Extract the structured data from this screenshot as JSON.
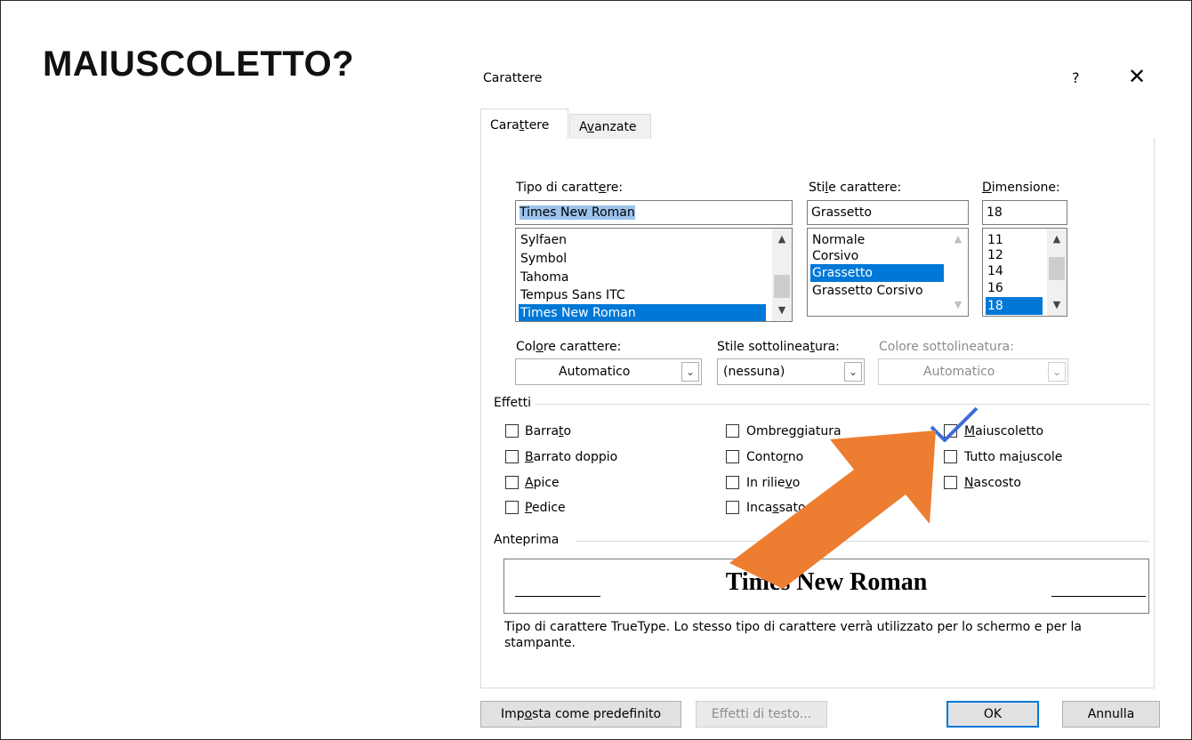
{
  "slide": {
    "title": "MAIUSCOLETTO?"
  },
  "dialog": {
    "title": "Carattere",
    "help_label": "?",
    "close_label": "✕",
    "tabs": [
      {
        "label": "Carattere",
        "active": true
      },
      {
        "label": "Avanzate",
        "active": false
      }
    ]
  },
  "font": {
    "label": "Tipo di carattere:",
    "value": "Times New Roman",
    "options": [
      "Sylfaen",
      "Symbol",
      "Tahoma",
      "Tempus Sans ITC",
      "Times New Roman"
    ],
    "selected": "Times New Roman"
  },
  "style": {
    "label": "Stile carattere:",
    "value": "Grassetto",
    "options": [
      "Normale",
      "Corsivo",
      "Grassetto",
      "Grassetto Corsivo"
    ],
    "selected": "Grassetto"
  },
  "size": {
    "label": "Dimensione:",
    "value": "18",
    "options": [
      "11",
      "12",
      "14",
      "16",
      "18"
    ],
    "selected": "18"
  },
  "font_color": {
    "label": "Colore carattere:",
    "value": "Automatico"
  },
  "underline_style": {
    "label": "Stile sottolineatura:",
    "value": "(nessuna)"
  },
  "underline_color": {
    "label": "Colore sottolineatura:",
    "value": "Automatico",
    "disabled": true
  },
  "effects": {
    "label": "Effetti",
    "items": [
      {
        "label": "Barrato",
        "checked": false
      },
      {
        "label": "Barrato doppio",
        "checked": false
      },
      {
        "label": "Apice",
        "checked": false
      },
      {
        "label": "Pedice",
        "checked": false
      },
      {
        "label": "Ombreggiatura",
        "checked": false
      },
      {
        "label": "Contorno",
        "checked": false
      },
      {
        "label": "In rilievo",
        "checked": false
      },
      {
        "label": "Incassato",
        "checked": false
      },
      {
        "label": "Maiuscoletto",
        "checked": true
      },
      {
        "label": "Tutto maiuscole",
        "checked": false
      },
      {
        "label": "Nascosto",
        "checked": false
      }
    ]
  },
  "preview": {
    "label": "Anteprima",
    "text": "Times New Roman",
    "description": "Tipo di carattere TrueType. Lo stesso tipo di carattere verrà utilizzato per lo schermo e per la stampante."
  },
  "buttons": {
    "set_default": "Imposta come predefinito",
    "text_effects": "Effetti di testo...",
    "ok": "OK",
    "cancel": "Annulla"
  },
  "colors": {
    "selection": "#0078d7",
    "arrow": "#ed7d31",
    "checkmark": "#3d6bd6"
  }
}
